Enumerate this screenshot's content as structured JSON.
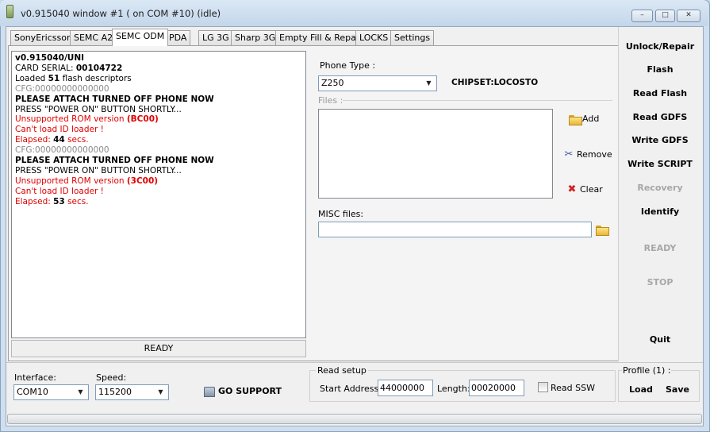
{
  "window": {
    "title": "v0.915040 window #1 ( on COM #10) (idle)",
    "min_glyph": "–",
    "max_glyph": "□",
    "close_glyph": "✕"
  },
  "tabs": [
    {
      "label": "SonyEricsson"
    },
    {
      "label": "SEMC A2"
    },
    {
      "label": "SEMC ODM",
      "active": true
    },
    {
      "label": "PDA"
    },
    {
      "label": "LG 3G"
    },
    {
      "label": "Sharp 3G"
    },
    {
      "label": "Empty Fill & Repair"
    },
    {
      "label": "LOCKS"
    },
    {
      "label": "Settings"
    }
  ],
  "log": {
    "lines": [
      {
        "parts": [
          {
            "t": "v0.915040/UNI",
            "s": "b"
          }
        ]
      },
      {
        "parts": [
          {
            "t": "CARD SERIAL: "
          },
          {
            "t": "00104722",
            "s": "b"
          }
        ]
      },
      {
        "parts": [
          {
            "t": "Loaded "
          },
          {
            "t": "51",
            "s": "b"
          },
          {
            "t": " flash descriptors"
          }
        ]
      },
      {
        "parts": [
          {
            "t": "CFG:00000000000000",
            "s": "grey"
          }
        ]
      },
      {
        "parts": [
          {
            "t": "PLEASE ATTACH TURNED OFF PHONE NOW",
            "s": "b"
          }
        ]
      },
      {
        "parts": [
          {
            "t": "PRESS \"POWER ON\" BUTTON SHORTLY..."
          }
        ]
      },
      {
        "parts": [
          {
            "t": "Unsupported ROM version ",
            "s": "red"
          },
          {
            "t": "(BC00)",
            "s": "red b"
          }
        ]
      },
      {
        "parts": [
          {
            "t": "Can't load ID loader !",
            "s": "red"
          }
        ]
      },
      {
        "parts": [
          {
            "t": "Elapsed: ",
            "s": "red"
          },
          {
            "t": "44",
            "s": "b"
          },
          {
            "t": " secs.",
            "s": "red"
          }
        ]
      },
      {
        "parts": [
          {
            "t": "CFG:00000000000000",
            "s": "grey"
          }
        ]
      },
      {
        "parts": [
          {
            "t": "PLEASE ATTACH TURNED OFF PHONE NOW",
            "s": "b"
          }
        ]
      },
      {
        "parts": [
          {
            "t": "PRESS \"POWER ON\" BUTTON SHORTLY..."
          }
        ]
      },
      {
        "parts": [
          {
            "t": "Unsupported ROM version ",
            "s": "red"
          },
          {
            "t": "(3C00)",
            "s": "red b"
          }
        ]
      },
      {
        "parts": [
          {
            "t": "Can't load ID loader !",
            "s": "red"
          }
        ]
      },
      {
        "parts": [
          {
            "t": "Elapsed: ",
            "s": "red"
          },
          {
            "t": "53",
            "s": "b"
          },
          {
            "t": " secs.",
            "s": "red"
          }
        ]
      }
    ],
    "status": "READY"
  },
  "phone": {
    "type_label": "Phone Type :",
    "type_value": "Z250",
    "chipset": "CHIPSET:LOCOSTO"
  },
  "files": {
    "label": "Files :",
    "add": "Add",
    "remove": "Remove",
    "clear": "Clear",
    "misc_label": "MISC files:",
    "misc_value": ""
  },
  "sidebar": {
    "unlock": "Unlock/Repair",
    "flash": "Flash",
    "read_flash": "Read Flash",
    "read_gdfs": "Read GDFS",
    "write_gdfs": "Write GDFS",
    "write_script": "Write SCRIPT",
    "recovery": "Recovery",
    "identify": "Identify",
    "ready": "READY",
    "stop": "STOP",
    "quit": "Quit"
  },
  "bottom": {
    "interface_label": "Interface:",
    "interface_value": "COM10",
    "speed_label": "Speed:",
    "speed_value": "115200",
    "go_support": "GO SUPPORT",
    "read_setup": "Read setup",
    "start_label": "Start Address:",
    "start_value": "44000000",
    "length_label": "Length:",
    "length_value": "00020000",
    "read_ssw": "Read SSW",
    "profile": "Profile (1) :",
    "load": "Load",
    "save": "Save"
  },
  "icons": {
    "dropdown_arrow": "▼",
    "scissors": "✂",
    "clear_x": "✖"
  },
  "colors": {
    "error_red": "#e00000",
    "disabled_grey": "#a7a7a7"
  }
}
